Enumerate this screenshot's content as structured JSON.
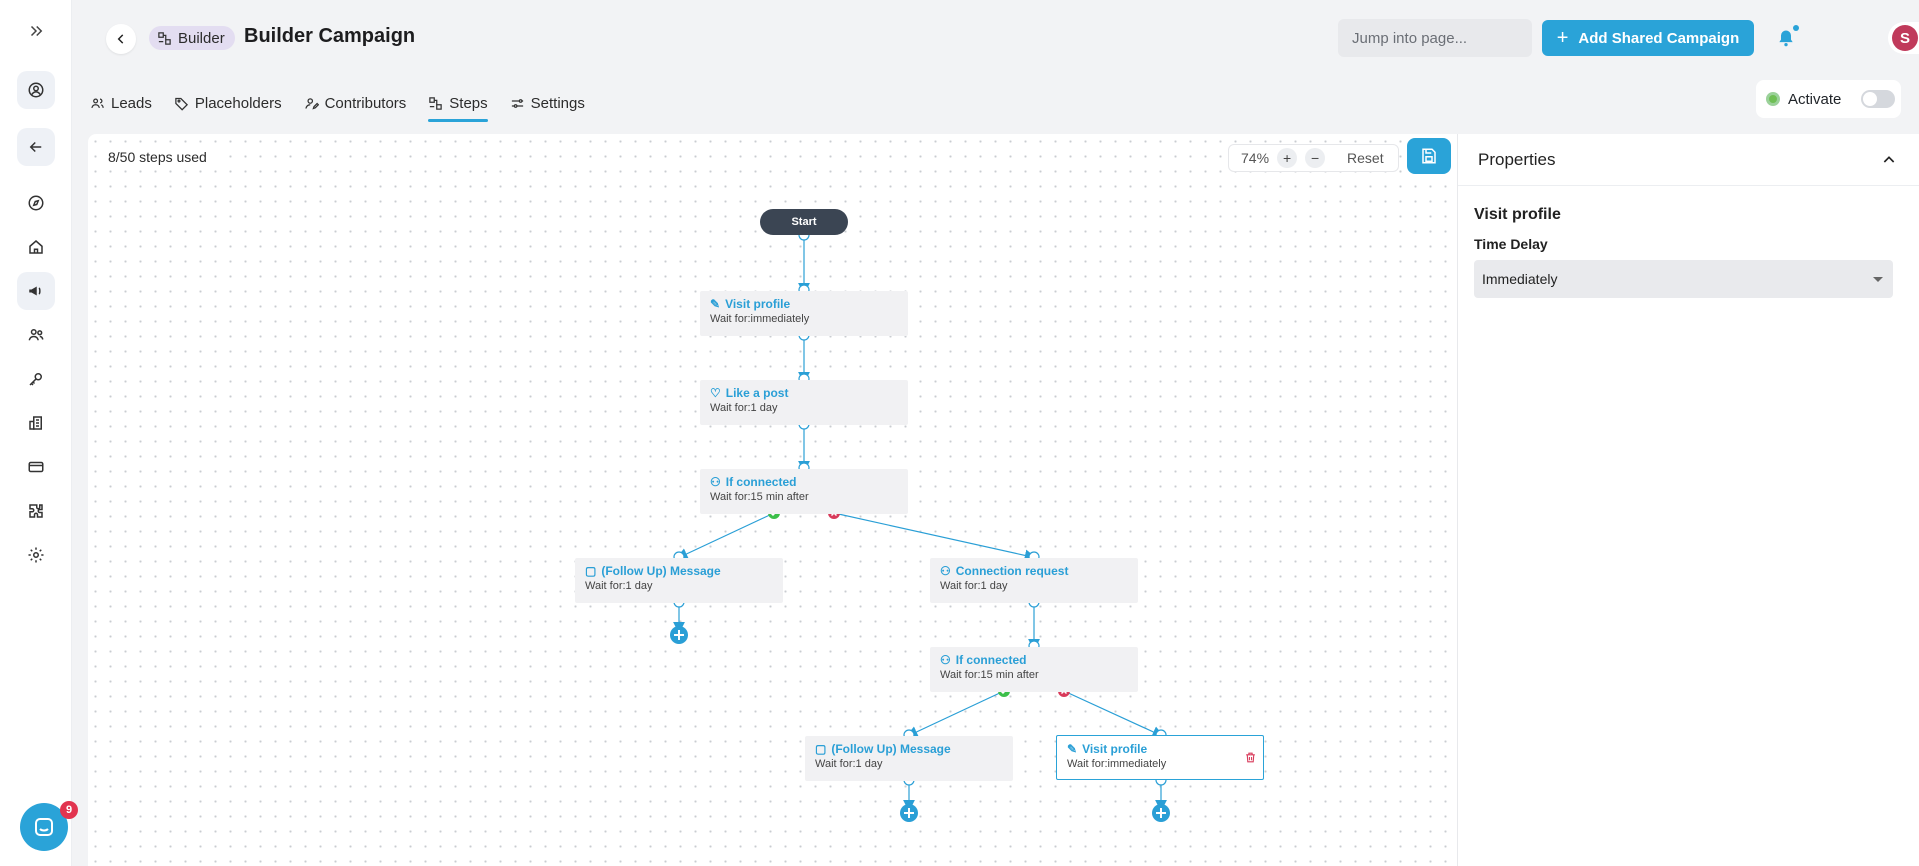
{
  "header": {
    "breadcrumb_label": "Builder",
    "title": "Builder Campaign",
    "search_placeholder": "Jump into page...",
    "add_button_label": "Add Shared Campaign",
    "avatar_initial": "S"
  },
  "tabs": [
    {
      "label": "Leads",
      "icon": "users-icon"
    },
    {
      "label": "Placeholders",
      "icon": "tag-icon"
    },
    {
      "label": "Contributors",
      "icon": "user-edit-icon"
    },
    {
      "label": "Steps",
      "icon": "steps-icon",
      "active": true
    },
    {
      "label": "Settings",
      "icon": "sliders-icon"
    }
  ],
  "activate_label": "Activate",
  "canvas": {
    "steps_used": "8/50 steps used",
    "zoom": "74%",
    "zoom_in": "+",
    "zoom_out": "−",
    "reset_label": "Reset"
  },
  "flow": {
    "start_label": "Start",
    "nodes": [
      {
        "title": "Visit profile",
        "subtitle": "Wait for:immediately",
        "icon": "edit-icon"
      },
      {
        "title": "Like a post",
        "subtitle": "Wait for:1 day",
        "icon": "heart-icon"
      },
      {
        "title": "If connected",
        "subtitle": "Wait for:15 min after",
        "icon": "user-check-icon"
      },
      {
        "title": "(Follow Up) Message",
        "subtitle": "Wait for:1 day",
        "icon": "message-icon"
      },
      {
        "title": "Connection request",
        "subtitle": "Wait for:1 day",
        "icon": "user-plus-icon"
      },
      {
        "title": "If connected",
        "subtitle": "Wait for:15 min after",
        "icon": "user-check-icon"
      },
      {
        "title": "(Follow Up) Message",
        "subtitle": "Wait for:1 day",
        "icon": "message-icon"
      },
      {
        "title": "Visit profile",
        "subtitle": "Wait for:immediately",
        "icon": "edit-icon",
        "selected": true
      }
    ]
  },
  "properties": {
    "heading": "Properties",
    "step_name": "Visit profile",
    "field_label": "Time Delay",
    "field_value": "Immediately"
  },
  "chat_badge": "9",
  "colors": {
    "accent": "#2aa3d8",
    "success": "#3cbf4a",
    "danger": "#d83a5a",
    "start_node": "#3b4553"
  }
}
